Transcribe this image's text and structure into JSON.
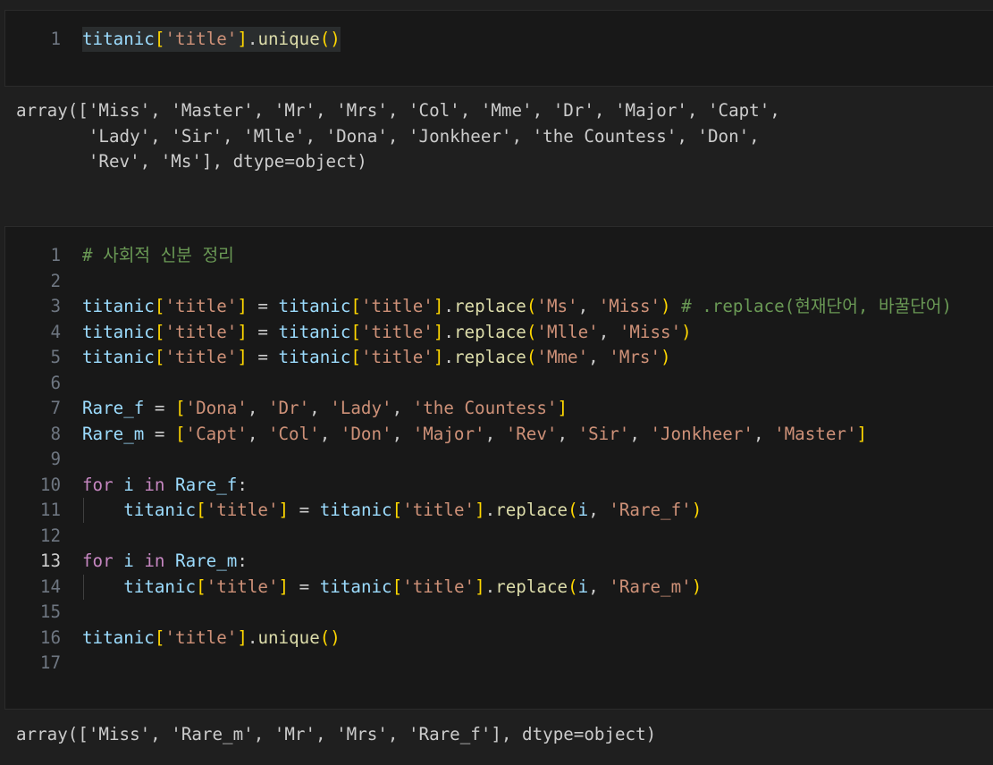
{
  "cell1": {
    "lines": [
      {
        "n": "1",
        "tokens": [
          {
            "t": "titanic",
            "c": "v"
          },
          {
            "t": "[",
            "c": "b1"
          },
          {
            "t": "'title'",
            "c": "s"
          },
          {
            "t": "]",
            "c": "b1"
          },
          {
            "t": ".",
            "c": "p"
          },
          {
            "t": "unique",
            "c": "f"
          },
          {
            "t": "()",
            "c": "b1"
          }
        ]
      }
    ],
    "output": "array(['Miss', 'Master', 'Mr', 'Mrs', 'Col', 'Mme', 'Dr', 'Major', 'Capt',\n       'Lady', 'Sir', 'Mlle', 'Dona', 'Jonkheer', 'the Countess', 'Don',\n       'Rev', 'Ms'], dtype=object)"
  },
  "cell2": {
    "lines": [
      {
        "n": "1",
        "tokens": [
          {
            "t": "# 사회적 신분 정리",
            "c": "c"
          }
        ]
      },
      {
        "n": "2",
        "tokens": []
      },
      {
        "n": "3",
        "tokens": [
          {
            "t": "titanic",
            "c": "v"
          },
          {
            "t": "[",
            "c": "b1"
          },
          {
            "t": "'title'",
            "c": "s"
          },
          {
            "t": "]",
            "c": "b1"
          },
          {
            "t": " = ",
            "c": "p"
          },
          {
            "t": "titanic",
            "c": "v"
          },
          {
            "t": "[",
            "c": "b1"
          },
          {
            "t": "'title'",
            "c": "s"
          },
          {
            "t": "]",
            "c": "b1"
          },
          {
            "t": ".",
            "c": "p"
          },
          {
            "t": "replace",
            "c": "f"
          },
          {
            "t": "(",
            "c": "b1"
          },
          {
            "t": "'Ms'",
            "c": "s"
          },
          {
            "t": ", ",
            "c": "p"
          },
          {
            "t": "'Miss'",
            "c": "s"
          },
          {
            "t": ")",
            "c": "b1"
          },
          {
            "t": " # .replace(현재단어, 바꿀단어)",
            "c": "c"
          }
        ]
      },
      {
        "n": "4",
        "tokens": [
          {
            "t": "titanic",
            "c": "v"
          },
          {
            "t": "[",
            "c": "b1"
          },
          {
            "t": "'title'",
            "c": "s"
          },
          {
            "t": "]",
            "c": "b1"
          },
          {
            "t": " = ",
            "c": "p"
          },
          {
            "t": "titanic",
            "c": "v"
          },
          {
            "t": "[",
            "c": "b1"
          },
          {
            "t": "'title'",
            "c": "s"
          },
          {
            "t": "]",
            "c": "b1"
          },
          {
            "t": ".",
            "c": "p"
          },
          {
            "t": "replace",
            "c": "f"
          },
          {
            "t": "(",
            "c": "b1"
          },
          {
            "t": "'Mlle'",
            "c": "s"
          },
          {
            "t": ", ",
            "c": "p"
          },
          {
            "t": "'Miss'",
            "c": "s"
          },
          {
            "t": ")",
            "c": "b1"
          }
        ]
      },
      {
        "n": "5",
        "tokens": [
          {
            "t": "titanic",
            "c": "v"
          },
          {
            "t": "[",
            "c": "b1"
          },
          {
            "t": "'title'",
            "c": "s"
          },
          {
            "t": "]",
            "c": "b1"
          },
          {
            "t": " = ",
            "c": "p"
          },
          {
            "t": "titanic",
            "c": "v"
          },
          {
            "t": "[",
            "c": "b1"
          },
          {
            "t": "'title'",
            "c": "s"
          },
          {
            "t": "]",
            "c": "b1"
          },
          {
            "t": ".",
            "c": "p"
          },
          {
            "t": "replace",
            "c": "f"
          },
          {
            "t": "(",
            "c": "b1"
          },
          {
            "t": "'Mme'",
            "c": "s"
          },
          {
            "t": ", ",
            "c": "p"
          },
          {
            "t": "'Mrs'",
            "c": "s"
          },
          {
            "t": ")",
            "c": "b1"
          }
        ]
      },
      {
        "n": "6",
        "tokens": []
      },
      {
        "n": "7",
        "tokens": [
          {
            "t": "Rare_f",
            "c": "v"
          },
          {
            "t": " = ",
            "c": "p"
          },
          {
            "t": "[",
            "c": "b1"
          },
          {
            "t": "'Dona'",
            "c": "s"
          },
          {
            "t": ", ",
            "c": "p"
          },
          {
            "t": "'Dr'",
            "c": "s"
          },
          {
            "t": ", ",
            "c": "p"
          },
          {
            "t": "'Lady'",
            "c": "s"
          },
          {
            "t": ", ",
            "c": "p"
          },
          {
            "t": "'the Countess'",
            "c": "s"
          },
          {
            "t": "]",
            "c": "b1"
          }
        ]
      },
      {
        "n": "8",
        "tokens": [
          {
            "t": "Rare_m",
            "c": "v"
          },
          {
            "t": " = ",
            "c": "p"
          },
          {
            "t": "[",
            "c": "b1"
          },
          {
            "t": "'Capt'",
            "c": "s"
          },
          {
            "t": ", ",
            "c": "p"
          },
          {
            "t": "'Col'",
            "c": "s"
          },
          {
            "t": ", ",
            "c": "p"
          },
          {
            "t": "'Don'",
            "c": "s"
          },
          {
            "t": ", ",
            "c": "p"
          },
          {
            "t": "'Major'",
            "c": "s"
          },
          {
            "t": ", ",
            "c": "p"
          },
          {
            "t": "'Rev'",
            "c": "s"
          },
          {
            "t": ", ",
            "c": "p"
          },
          {
            "t": "'Sir'",
            "c": "s"
          },
          {
            "t": ", ",
            "c": "p"
          },
          {
            "t": "'Jonkheer'",
            "c": "s"
          },
          {
            "t": ", ",
            "c": "p"
          },
          {
            "t": "'Master'",
            "c": "s"
          },
          {
            "t": "]",
            "c": "b1"
          }
        ]
      },
      {
        "n": "9",
        "tokens": []
      },
      {
        "n": "10",
        "tokens": [
          {
            "t": "for",
            "c": "k"
          },
          {
            "t": " ",
            "c": "p"
          },
          {
            "t": "i",
            "c": "v"
          },
          {
            "t": " ",
            "c": "p"
          },
          {
            "t": "in",
            "c": "k"
          },
          {
            "t": " ",
            "c": "p"
          },
          {
            "t": "Rare_f",
            "c": "v"
          },
          {
            "t": ":",
            "c": "p"
          }
        ]
      },
      {
        "n": "11",
        "guide": true,
        "tokens": [
          {
            "t": "    ",
            "c": "p"
          },
          {
            "t": "titanic",
            "c": "v"
          },
          {
            "t": "[",
            "c": "b1"
          },
          {
            "t": "'title'",
            "c": "s"
          },
          {
            "t": "]",
            "c": "b1"
          },
          {
            "t": " = ",
            "c": "p"
          },
          {
            "t": "titanic",
            "c": "v"
          },
          {
            "t": "[",
            "c": "b1"
          },
          {
            "t": "'title'",
            "c": "s"
          },
          {
            "t": "]",
            "c": "b1"
          },
          {
            "t": ".",
            "c": "p"
          },
          {
            "t": "replace",
            "c": "f"
          },
          {
            "t": "(",
            "c": "b1"
          },
          {
            "t": "i",
            "c": "v"
          },
          {
            "t": ", ",
            "c": "p"
          },
          {
            "t": "'Rare_f'",
            "c": "s"
          },
          {
            "t": ")",
            "c": "b1"
          }
        ]
      },
      {
        "n": "12",
        "tokens": []
      },
      {
        "n": "13",
        "active": true,
        "tokens": [
          {
            "t": "for",
            "c": "k"
          },
          {
            "t": " ",
            "c": "p"
          },
          {
            "t": "i",
            "c": "v"
          },
          {
            "t": " ",
            "c": "p"
          },
          {
            "t": "in",
            "c": "k"
          },
          {
            "t": " ",
            "c": "p"
          },
          {
            "t": "Rare_m",
            "c": "v"
          },
          {
            "t": ":",
            "c": "p"
          }
        ]
      },
      {
        "n": "14",
        "guide": true,
        "tokens": [
          {
            "t": "    ",
            "c": "p"
          },
          {
            "t": "titanic",
            "c": "v"
          },
          {
            "t": "[",
            "c": "b1"
          },
          {
            "t": "'title'",
            "c": "s"
          },
          {
            "t": "]",
            "c": "b1"
          },
          {
            "t": " = ",
            "c": "p"
          },
          {
            "t": "titanic",
            "c": "v"
          },
          {
            "t": "[",
            "c": "b1"
          },
          {
            "t": "'title'",
            "c": "s"
          },
          {
            "t": "]",
            "c": "b1"
          },
          {
            "t": ".",
            "c": "p"
          },
          {
            "t": "replace",
            "c": "f"
          },
          {
            "t": "(",
            "c": "b1"
          },
          {
            "t": "i",
            "c": "v"
          },
          {
            "t": ", ",
            "c": "p"
          },
          {
            "t": "'Rare_m'",
            "c": "s"
          },
          {
            "t": ")",
            "c": "b1"
          }
        ]
      },
      {
        "n": "15",
        "tokens": []
      },
      {
        "n": "16",
        "tokens": [
          {
            "t": "titanic",
            "c": "v"
          },
          {
            "t": "[",
            "c": "b1"
          },
          {
            "t": "'title'",
            "c": "s"
          },
          {
            "t": "]",
            "c": "b1"
          },
          {
            "t": ".",
            "c": "p"
          },
          {
            "t": "unique",
            "c": "f"
          },
          {
            "t": "()",
            "c": "b1"
          }
        ]
      },
      {
        "n": "17",
        "tokens": []
      }
    ],
    "output": "array(['Miss', 'Rare_m', 'Mr', 'Mrs', 'Rare_f'], dtype=object)"
  },
  "colors": {
    "editor_bg": "#181818",
    "page_bg": "#1f1f1f",
    "variable": "#9cdcfe",
    "string": "#ce9178",
    "function": "#dcdcaa",
    "comment": "#6a9955",
    "keyword": "#c586c0",
    "bracket": "#ffd700",
    "line_number": "#6e7681"
  }
}
